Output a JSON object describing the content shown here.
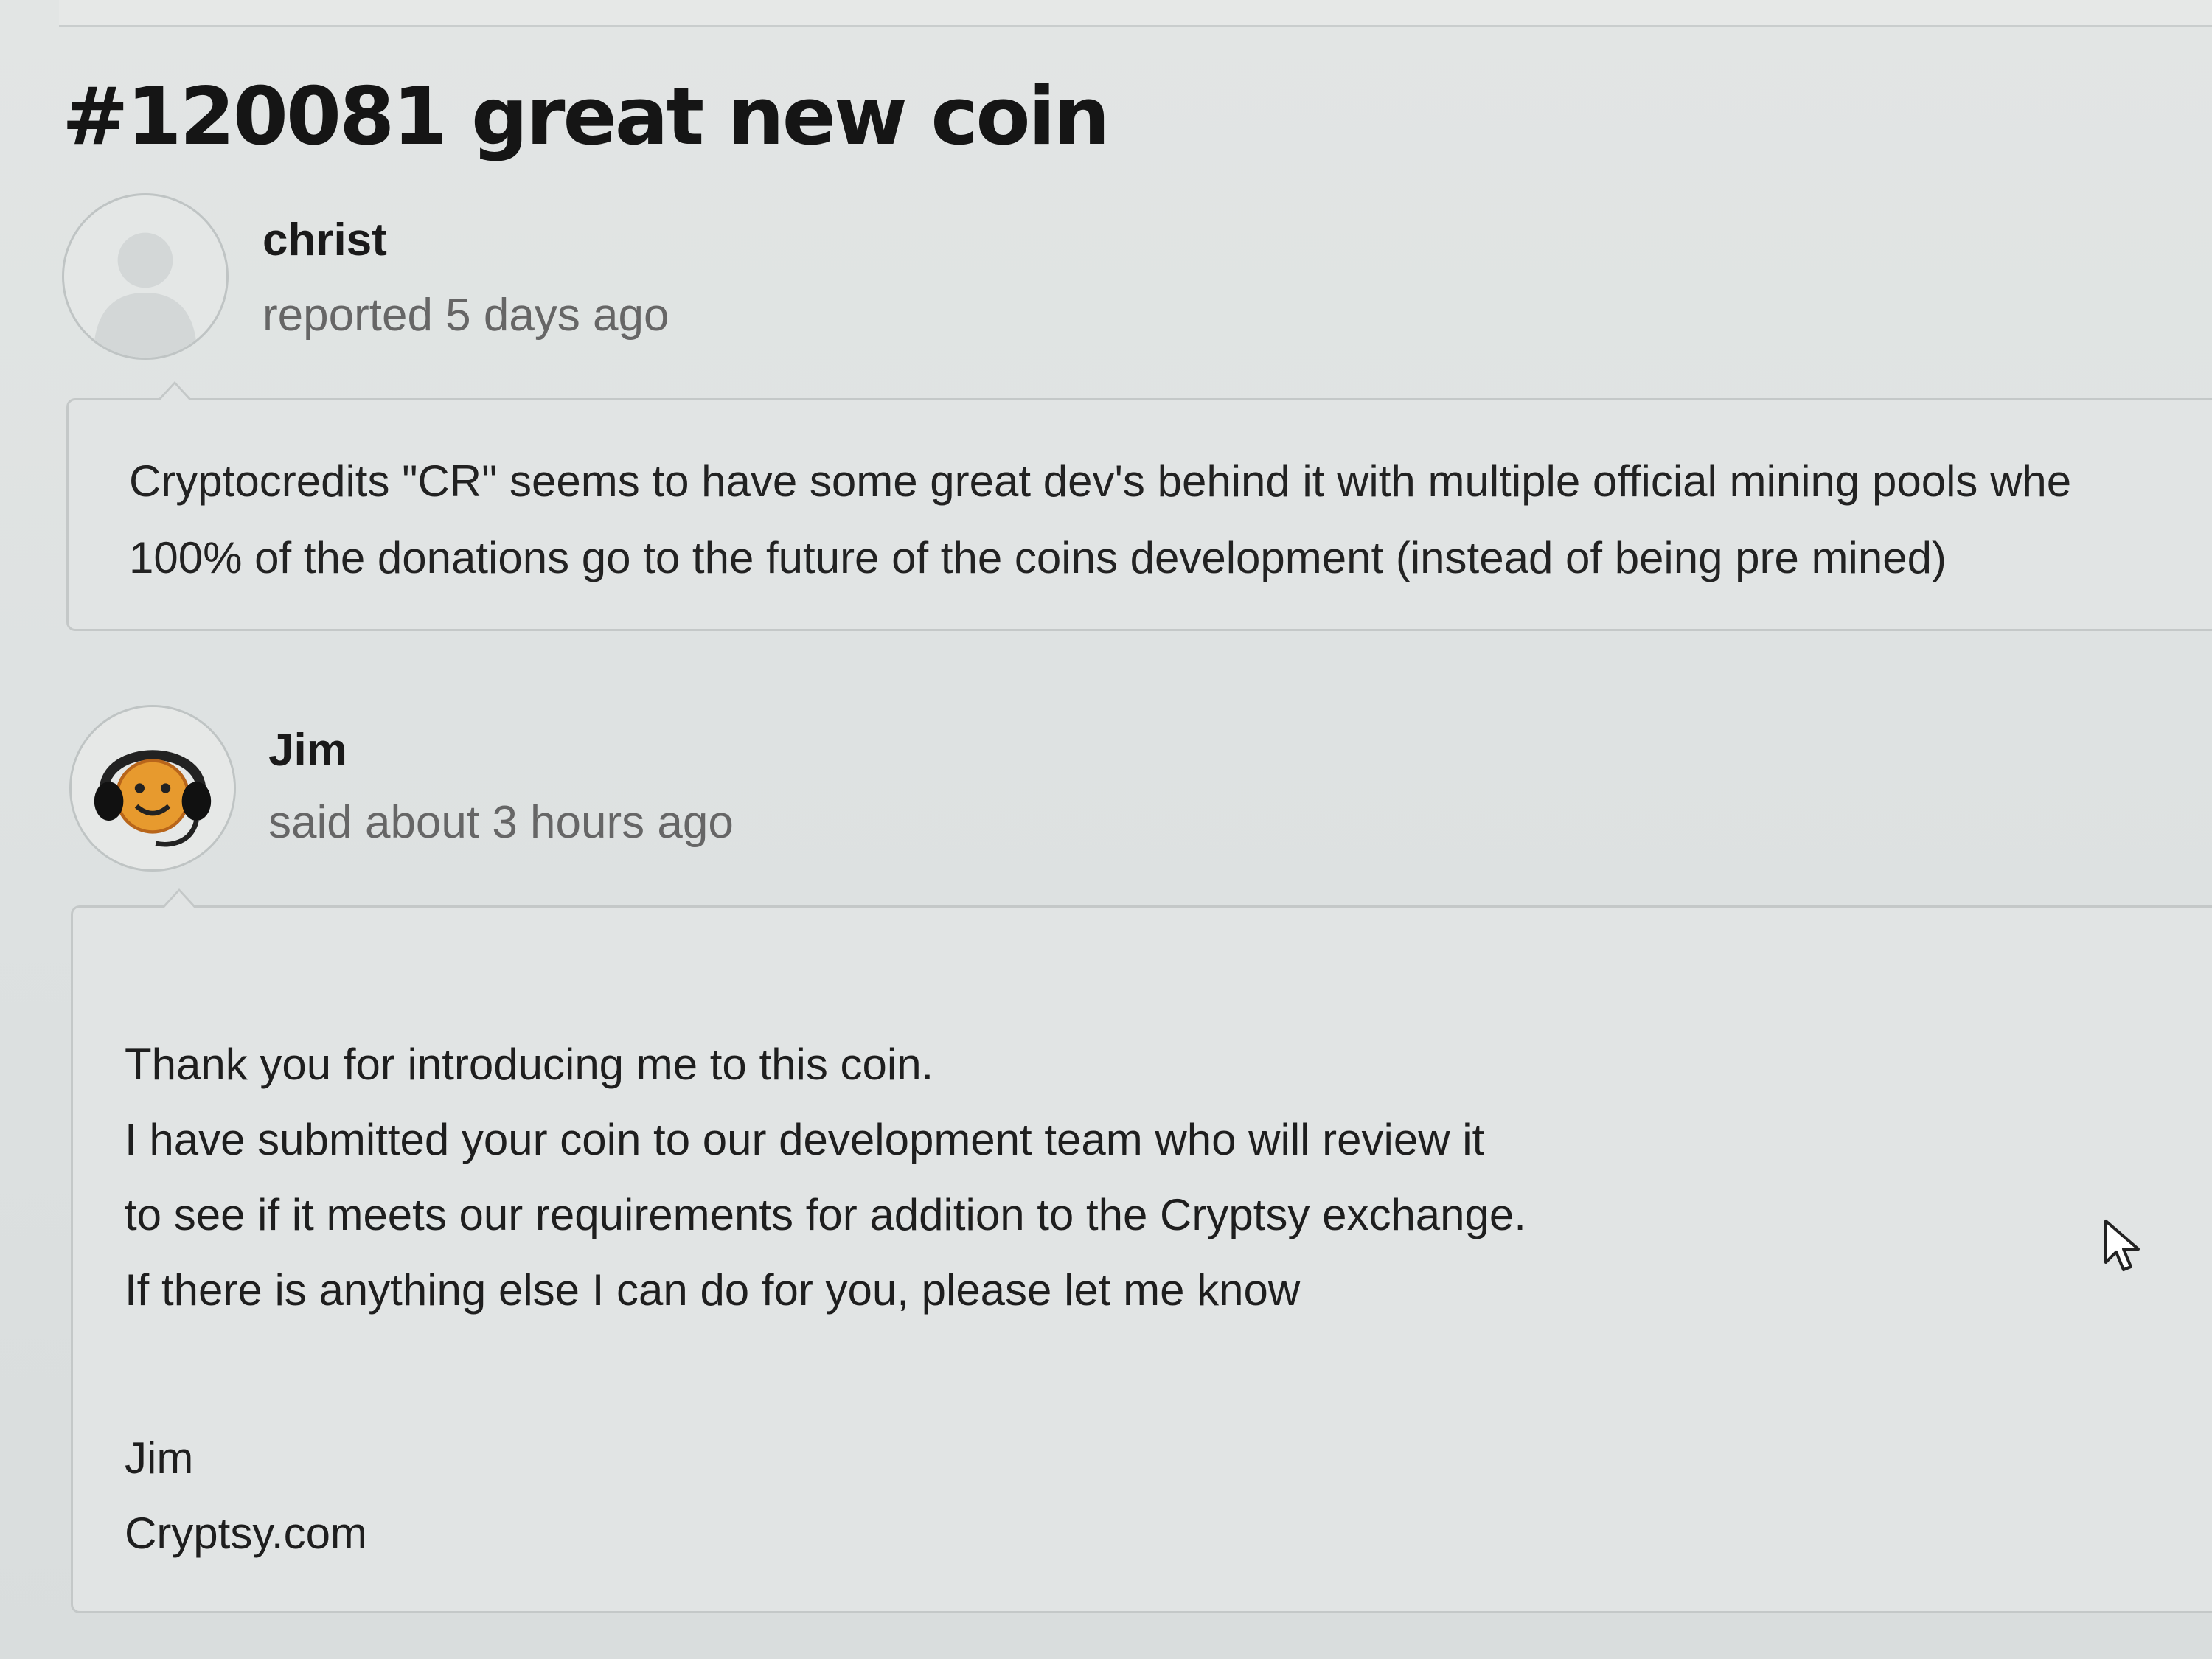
{
  "ticket": {
    "title": "#120081 great new coin"
  },
  "report": {
    "author": "christ",
    "meta": "reported 5 days ago",
    "avatar_icon": "default-user-avatar-icon",
    "body_lines": [
      "Cryptocredits \"CR\" seems to have some great dev's behind it with multiple official mining pools whe",
      "100% of the donations go to the future of the coins development (instead of being pre mined)"
    ]
  },
  "reply": {
    "author": "Jim",
    "meta": "said about 3 hours ago",
    "avatar_icon": "support-agent-headset-smiley-icon",
    "body_lines": [
      "Thank you for introducing me to this coin.",
      "I have submitted your coin to our development team who will review it",
      "to see if it meets our requirements for addition to the Cryptsy exchange.",
      "If there is anything else I can do for you, please let me know",
      "Jim",
      "Cryptsy.com"
    ]
  },
  "cursor_icon": "mouse-pointer-icon"
}
